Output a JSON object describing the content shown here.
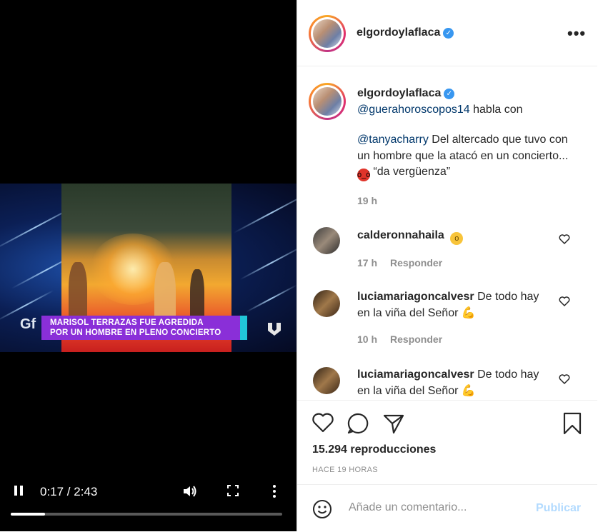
{
  "video": {
    "banner_line1": "MARISOL TERRAZAS FUE AGREDIDA",
    "banner_line2": "POR UN HOMBRE EN PLENO CONCIERTO",
    "show_logo": "Gf",
    "time_display": "0:17 / 2:43",
    "progress_fraction": 0.125,
    "icons": [
      "pause-icon",
      "volume-icon",
      "fullscreen-icon",
      "more-options-icon"
    ]
  },
  "header": {
    "username": "elgordoylaflaca",
    "verified": true
  },
  "caption": {
    "username": "elgordoylaflaca",
    "mention1": "@guerahoroscopos14",
    "text1": " habla con",
    "mention2": "@tanyacharry",
    "text2": " Del altercado que tuvo con un hombre que la atacó en un concierto... ",
    "text3": " “da vergüenza”",
    "time": "19 h"
  },
  "comments": [
    {
      "username": "calderonnahaila",
      "text": "",
      "emoji": "astonished-face",
      "time": "17 h",
      "reply": "Responder"
    },
    {
      "username": "luciamariagoncalvesr",
      "text": "De todo hay en la viña del Señor",
      "emoji": "flexed-biceps",
      "time": "10 h",
      "reply": "Responder"
    },
    {
      "username": "luciamariagoncalvesr",
      "text": "De todo hay en la viña del Señor",
      "emoji": "flexed-biceps"
    }
  ],
  "actions": {
    "views": "15.294 reproducciones",
    "posted": "HACE 19 HORAS"
  },
  "add_comment": {
    "placeholder": "Añade un comentario...",
    "publish": "Publicar"
  },
  "colors": {
    "link": "#00376b",
    "verified": "#3897f0",
    "publish_disabled": "#b3dbff",
    "banner_purple": "#8a2fd8",
    "banner_cyan": "#21c6d8"
  }
}
